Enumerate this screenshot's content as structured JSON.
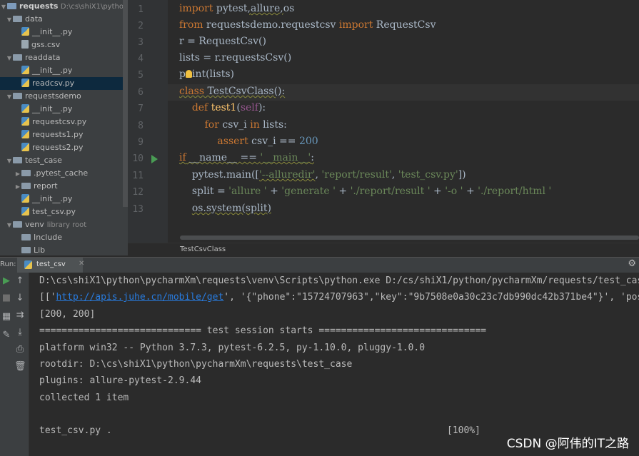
{
  "tree": {
    "root_label": "requests",
    "root_path": "D:\\cs\\shiX1\\python\\p",
    "items": [
      {
        "label": "data",
        "kind": "folder"
      },
      {
        "label": "__init__.py",
        "kind": "py"
      },
      {
        "label": "gss.csv",
        "kind": "csv"
      },
      {
        "label": "readdata",
        "kind": "folder"
      },
      {
        "label": "__init__.py",
        "kind": "py"
      },
      {
        "label": "readcsv.py",
        "kind": "py",
        "selected": true
      },
      {
        "label": "requestsdemo",
        "kind": "folder"
      },
      {
        "label": "__init__.py",
        "kind": "py"
      },
      {
        "label": "requestcsv.py",
        "kind": "py"
      },
      {
        "label": "requests1.py",
        "kind": "py"
      },
      {
        "label": "requests2.py",
        "kind": "py"
      },
      {
        "label": "test_case",
        "kind": "folder"
      },
      {
        "label": ".pytest_cache",
        "kind": "folder"
      },
      {
        "label": "report",
        "kind": "folder"
      },
      {
        "label": "__init__.py",
        "kind": "py"
      },
      {
        "label": "test_csv.py",
        "kind": "py"
      },
      {
        "label": "venv",
        "kind": "folder",
        "note": "library root"
      },
      {
        "label": "Include",
        "kind": "folder"
      },
      {
        "label": "Lib",
        "kind": "folder"
      }
    ]
  },
  "editor": {
    "line_numbers": [
      "1",
      "2",
      "3",
      "4",
      "5",
      "6",
      "7",
      "8",
      "9",
      "10",
      "11",
      "12",
      "13"
    ],
    "lines": {
      "l1": {
        "kw": "import",
        "rest_a": " pytest",
        "sep": ",",
        "mod": "allure",
        "sep2": ",",
        "rest_b": "os"
      },
      "l2": {
        "kw1": "from",
        "mod": " requestsdemo.requestcsv ",
        "kw2": "import",
        "rest": " RequestCsv"
      },
      "l3": {
        "text": "r = RequestCsv()"
      },
      "l4": {
        "text": "lists = r.requestsCsv()"
      },
      "l5": {
        "pre": "p",
        "post": "int(lists)"
      },
      "l6": {
        "kw": "class",
        "name": " TestCsvClass",
        "rest": "():"
      },
      "l7": {
        "kw": "def",
        "name": " test1",
        "open": "(",
        "self": "self",
        "close": "):"
      },
      "l8": {
        "kw1": "for",
        "mid": " csv_i ",
        "kw2": "in",
        "rest": " lists:"
      },
      "l9": {
        "kw": "assert",
        "mid": " csv_i == ",
        "num": "200"
      },
      "l10": {
        "kw": "if",
        "mid": " __name__ == ",
        "str": "'__main__'",
        "rest": ":"
      },
      "l11": {
        "a": "pytest.main([",
        "s1": "'--alluredir'",
        "b": ", ",
        "s2": "'report/result'",
        "c": ", ",
        "s3": "'test_csv.py'",
        "d": "])"
      },
      "l12": {
        "a": "split = ",
        "s1": "'allure '",
        "b": " + ",
        "s2": "'generate '",
        "c": " + ",
        "s3": "'./report/result '",
        "d": " + ",
        "s4": "'-o '",
        "e": " + ",
        "s5": "'./report/html '"
      },
      "l13": {
        "text": "os.system(split)"
      }
    },
    "breadcrumb": "TestCsvClass"
  },
  "run": {
    "label": "Run:",
    "tab_label": "test_csv",
    "console": {
      "line1": "D:\\cs\\shiX1\\python\\pycharmXm\\requests\\venv\\Scripts\\python.exe D:/cs/shiX1/python/pycharmXm/requests/test_cas",
      "line2_pre": "[['",
      "line2_link": "http://apis.juhe.cn/mobile/get",
      "line2_post": "', '{\"phone\":\"15724707963\",\"key\":\"9b7508e0a30c23c7db990dc42b371be4\"}', 'pos",
      "line3": "[200, 200]",
      "line4": "============================= test session starts ==============================",
      "line5": "platform win32 -- Python 3.7.3, pytest-6.2.5, py-1.10.0, pluggy-1.0.0",
      "line6": "rootdir: D:\\cs\\shiX1\\python\\pycharmXm\\requests\\test_case",
      "line7": "plugins: allure-pytest-2.9.44",
      "line8": "collected 1 item",
      "line9": "test_csv.py .",
      "pct": "[100%]"
    }
  },
  "watermark": "CSDN @阿伟的IT之路"
}
